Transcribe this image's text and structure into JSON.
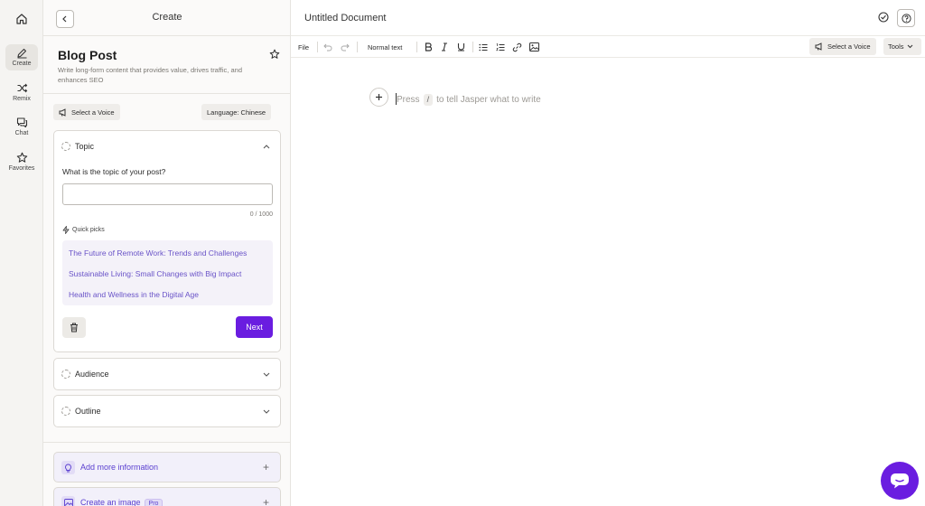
{
  "rail": {
    "items": [
      {
        "label": ""
      },
      {
        "label": "Create"
      },
      {
        "label": "Remix"
      },
      {
        "label": "Chat"
      },
      {
        "label": "Favorites"
      }
    ]
  },
  "panel": {
    "header_title": "Create",
    "template_title": "Blog Post",
    "template_description": "Write long-form content that provides value, drives traffic, and enhances SEO",
    "voice_button": "Select a Voice",
    "language_button": "Language: Chinese",
    "topic": {
      "title": "Topic",
      "question": "What is the topic of your post?",
      "input_value": "",
      "counter": "0 / 1000",
      "quick_picks_label": "Quick picks",
      "quick_picks": [
        "The Future of Remote Work: Trends and Challenges",
        "Sustainable Living: Small Changes with Big Impact",
        "Health and Wellness in the Digital Age"
      ],
      "next_label": "Next"
    },
    "audience_title": "Audience",
    "outline_title": "Outline",
    "add_info_label": "Add more information",
    "create_image_label": "Create an image",
    "pro_badge": "Pro"
  },
  "doc": {
    "title": "Untitled Document",
    "toolbar": {
      "file": "File",
      "text_style": "Normal text",
      "voice": "Select a Voice",
      "tools": "Tools"
    },
    "prompt_before": "Press",
    "prompt_key": "/",
    "prompt_after": "to tell Jasper what to write"
  },
  "colors": {
    "accent": "#6a1de0",
    "quick_pick_text": "#6a54c8"
  }
}
